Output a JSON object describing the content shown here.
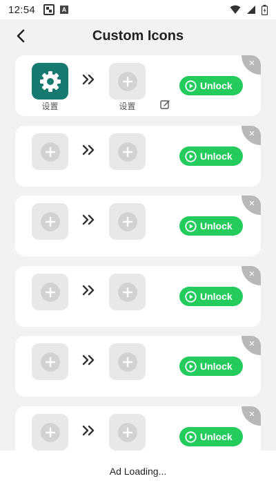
{
  "status_bar": {
    "time": "12:54",
    "icons": [
      "qr-code-icon",
      "a-notification-icon",
      "wifi-icon",
      "signal-icon",
      "battery-icon"
    ]
  },
  "header": {
    "title": "Custom Icons",
    "back_icon": "chevron-left-icon"
  },
  "theme": {
    "accent_green": "#24cc5e",
    "app_icon_teal": "#167a70",
    "card_bg": "#ffffff",
    "page_bg": "#f2f2f4",
    "placeholder_tile": "#e8e8ea",
    "close_corner": "#b8b8b8"
  },
  "cards": [
    {
      "source_icon": "settings-gear-icon",
      "source_label": "设置",
      "target_icon": "plus-icon",
      "target_label": "设置",
      "show_edit": true,
      "unlock_label": "Unlock"
    },
    {
      "source_icon": "plus-icon",
      "target_icon": "plus-icon",
      "unlock_label": "Unlock"
    },
    {
      "source_icon": "plus-icon",
      "target_icon": "plus-icon",
      "unlock_label": "Unlock"
    },
    {
      "source_icon": "plus-icon",
      "target_icon": "plus-icon",
      "unlock_label": "Unlock"
    },
    {
      "source_icon": "plus-icon",
      "target_icon": "plus-icon",
      "unlock_label": "Unlock"
    },
    {
      "source_icon": "plus-icon",
      "target_icon": "plus-icon",
      "unlock_label": "Unlock"
    }
  ],
  "ad": {
    "text": "Ad Loading..."
  }
}
